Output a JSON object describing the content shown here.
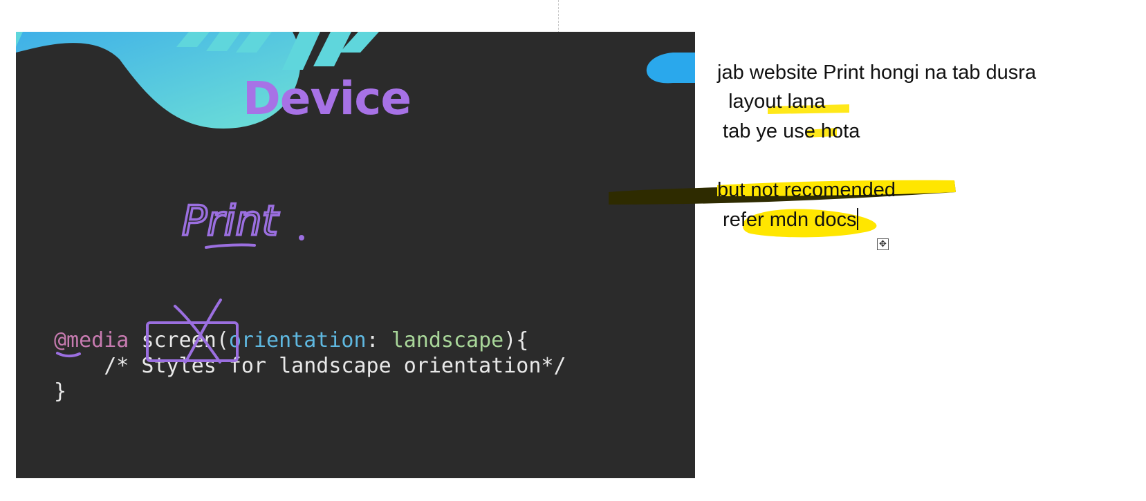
{
  "slide": {
    "title": "Device",
    "handwritten": "Print",
    "code": {
      "line1": {
        "at_rule": "@media",
        "media_type": "screen",
        "open_paren": "(",
        "property": "orientation",
        "colon": ": ",
        "value": "landscape",
        "close": "){"
      },
      "line2": "    /* Styles for landscape orientation*/",
      "line3": "}"
    },
    "colors": {
      "background": "#2b2b2b",
      "title": "#a772e6",
      "ink": "#9b6fe0",
      "blob_light": "#5fd6dc",
      "blob_dark": "#3fb0e8"
    }
  },
  "notes": {
    "line1": "jab website Print hongi na tab dusra",
    "line2": "  layout lana",
    "line3": " tab ye use hota",
    "line4": "but not recomended",
    "line5": " refer mdn docs",
    "highlight_color": "#ffe600"
  },
  "icons": {
    "move_handle": "move-icon"
  }
}
